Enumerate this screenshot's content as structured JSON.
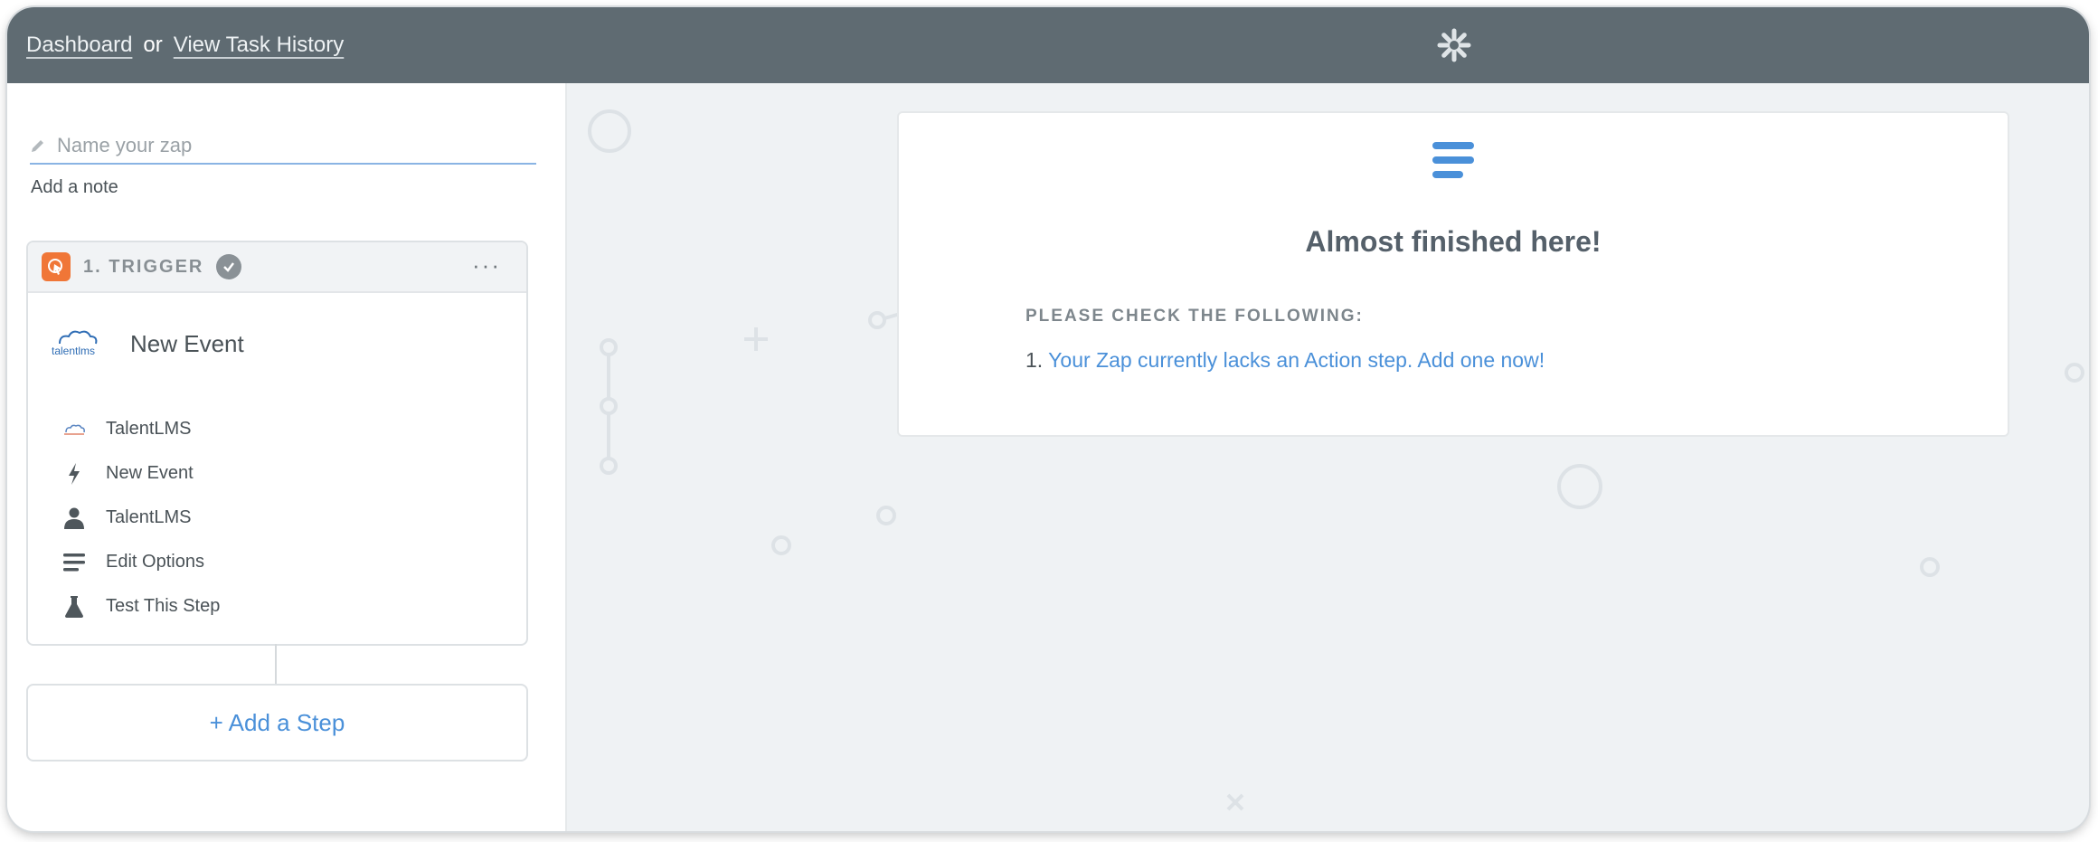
{
  "topbar": {
    "dashboard_link": "Dashboard",
    "separator": "or",
    "history_link": "View Task History",
    "logo_icon": "zapier-asterisk-icon"
  },
  "editor": {
    "name_placeholder": "Name your zap",
    "add_note": "Add a note"
  },
  "trigger": {
    "label": "1. TRIGGER",
    "status_icon": "check-circle-icon",
    "more_icon": "more-dots-icon",
    "event_title": "New Event",
    "app_logo_text": "talentlms",
    "steps": [
      {
        "icon": "talentlms-icon",
        "label": "TalentLMS"
      },
      {
        "icon": "bolt-icon",
        "label": "New Event"
      },
      {
        "icon": "user-icon",
        "label": "TalentLMS"
      },
      {
        "icon": "lines-icon",
        "label": "Edit Options"
      },
      {
        "icon": "flask-icon",
        "label": "Test This Step"
      }
    ]
  },
  "add_step": {
    "label": "+ Add a Step"
  },
  "notice": {
    "icon": "hamburger-icon",
    "title": "Almost finished here!",
    "subtitle": "PLEASE CHECK THE FOLLOWING:",
    "item_number": "1.",
    "item_text": "Your Zap currently lacks an Action step. Add one now!"
  },
  "colors": {
    "topbar": "#5f6b72",
    "accent_blue": "#4a90d9",
    "trigger_orange": "#f07637",
    "canvas_bg": "#eff2f4"
  }
}
